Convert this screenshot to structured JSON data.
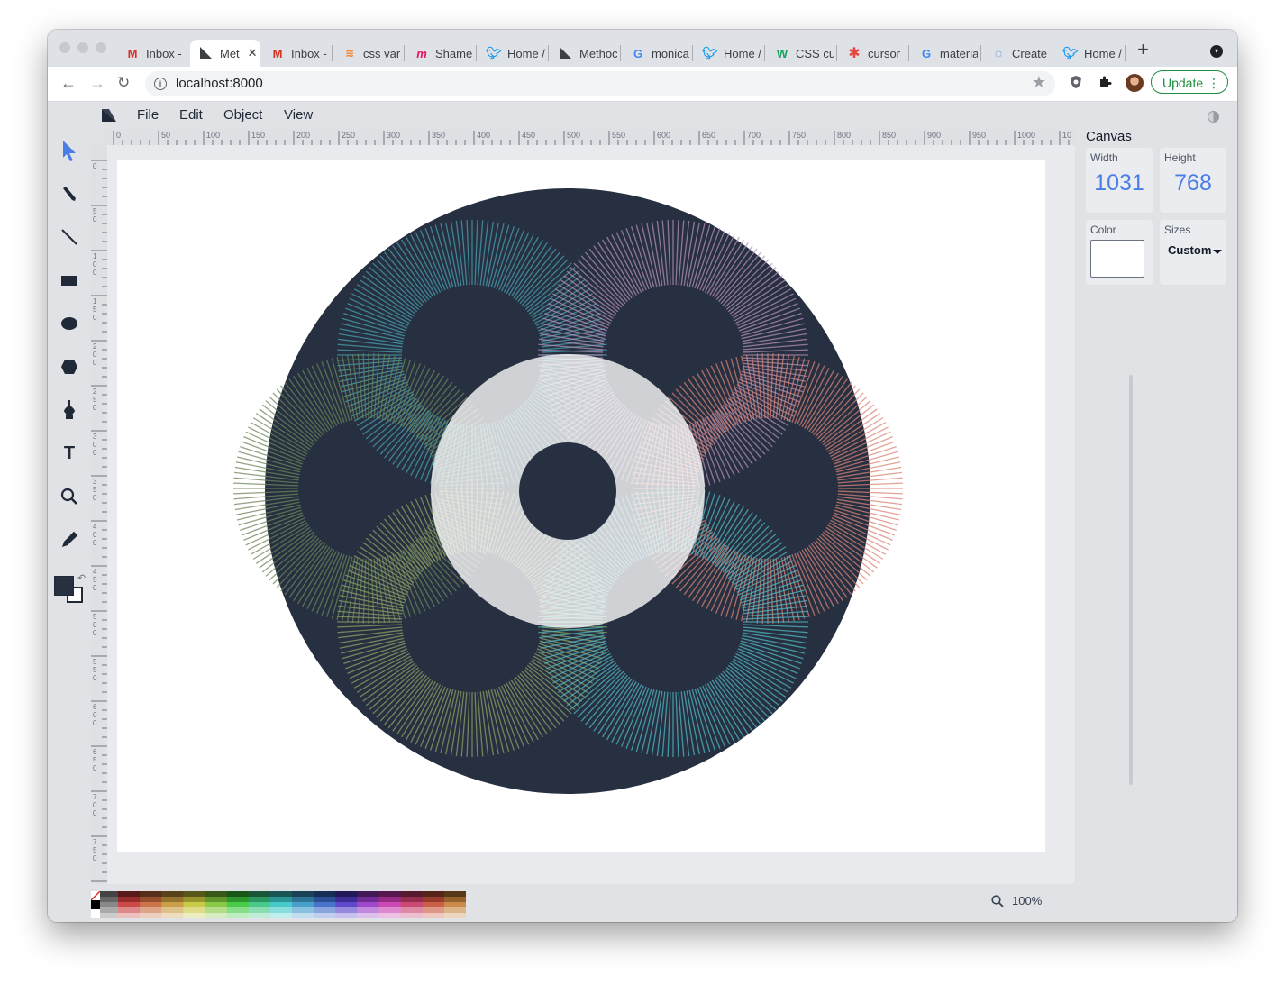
{
  "browser": {
    "tabs": [
      {
        "title": "Inbox -",
        "icon": "gmail-icon"
      },
      {
        "title": "Met",
        "icon": "method-draw-icon",
        "active": true
      },
      {
        "title": "Inbox -",
        "icon": "gmail-icon"
      },
      {
        "title": "css var",
        "icon": "stackoverflow-icon"
      },
      {
        "title": "Shame",
        "icon": "m-brand-icon"
      },
      {
        "title": "Home /",
        "icon": "twitter-icon"
      },
      {
        "title": "Methoc",
        "icon": "method-draw-icon"
      },
      {
        "title": "monica",
        "icon": "google-icon"
      },
      {
        "title": "Home /",
        "icon": "twitter-icon"
      },
      {
        "title": "CSS cu",
        "icon": "w-brand-icon"
      },
      {
        "title": "cursor",
        "icon": "asterisk-icon"
      },
      {
        "title": "materia",
        "icon": "google-icon"
      },
      {
        "title": "Create",
        "icon": "ring-icon"
      },
      {
        "title": "Home /",
        "icon": "twitter-icon"
      }
    ],
    "url": "localhost:8000",
    "update_label": "Update"
  },
  "app": {
    "menu": [
      "File",
      "Edit",
      "Object",
      "View"
    ],
    "ruler_labels": [
      "0",
      "50",
      "100",
      "150",
      "200",
      "250",
      "300",
      "350",
      "400",
      "450",
      "500",
      "550",
      "600",
      "650",
      "700",
      "750",
      "800",
      "850",
      "900",
      "950",
      "1000",
      "10"
    ],
    "tools": [
      "select-tool-icon",
      "pencil-tool-icon",
      "line-tool-icon",
      "rectangle-tool-icon",
      "ellipse-tool-icon",
      "polygon-tool-icon",
      "pen-tool-icon",
      "text-tool-icon",
      "zoom-tool-icon",
      "eyedropper-tool-icon"
    ],
    "fill_color": "#263041",
    "panel": {
      "title": "Canvas",
      "width_label": "Width",
      "width_value": "1031",
      "height_label": "Height",
      "height_value": "768",
      "color_label": "Color",
      "color_value": "#ffffff",
      "sizes_label": "Sizes",
      "sizes_value": "Custom"
    },
    "zoom": "100%"
  },
  "artwork": {
    "background": "#263041",
    "center_fill": "#ffffff",
    "ring_colors": [
      "#4aa0b0",
      "#b58fb8",
      "#d98375",
      "#52b8c4",
      "#8fa064",
      "#6d8458"
    ]
  }
}
